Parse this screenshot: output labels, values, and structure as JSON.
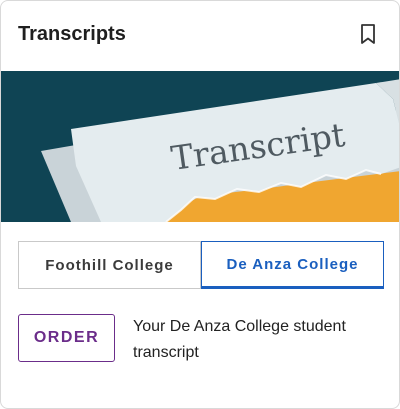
{
  "card": {
    "title": "Transcripts",
    "bookmark_icon": "bookmark-icon",
    "image_text": "Transcript"
  },
  "tabs": [
    {
      "label": "Foothill College",
      "active": false
    },
    {
      "label": "De Anza College",
      "active": true
    }
  ],
  "action": {
    "order_label": "ORDER",
    "description": "Your De Anza College student transcript"
  },
  "colors": {
    "accent_blue": "#1a5fbf",
    "order_purple": "#6b2d8a",
    "hero_background": "#0f4454",
    "paper_yellow": "#f0a630"
  }
}
